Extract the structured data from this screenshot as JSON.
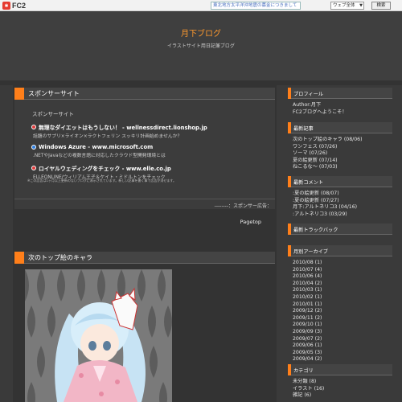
{
  "fc2bar": {
    "logo_text": "FC2",
    "notice": "東北地方太平洋沖地震の募金につきまして",
    "search_scope": "ウェブ全体",
    "search_button": "検索"
  },
  "header": {
    "title": "月下ブログ",
    "subtitle": "イラストサイト用日記兼ブログ"
  },
  "sponsor": {
    "heading": "スポンサーサイト",
    "label": "スポンサーサイト",
    "ads": [
      {
        "title": "無理なダイエットはもうしない！ - wellnessdirect.lionshop.jp",
        "desc": "話題のサプリ×ライオン×ラクトフェリン スッキリ計画始めませんか？",
        "icon": "red"
      },
      {
        "title": "Windows Azure - www.microsoft.com",
        "desc": ".NETやJavaなどの複数言語に対応したクラウド型開発環境とは",
        "icon": "blue"
      },
      {
        "title": "ロイヤルウェディングをチェック - www.elle.co.jp",
        "desc": "ELLEONLINE/ウィリアム王子＆ケイト・ミドルトンをチェック",
        "icon": "red"
      }
    ],
    "note": "※この広告は1ヶ月以上更新のないブログに表示されています。新しい記事を書く事で広告が消せます。",
    "footer": "--------：スポンサー広告："
  },
  "pagetop": "Pagetop",
  "entry": {
    "heading": "次のトップ絵のキャラ"
  },
  "sidebar": {
    "profile": {
      "heading": "プロフィール",
      "lines": [
        "Author:月下",
        "FC2ブログへようこそ！"
      ]
    },
    "recent_entries": {
      "heading": "最新記事",
      "items": [
        "次のトップ絵のキャラ (08/06)",
        "ワンフェス (07/26)",
        "ソーマ (07/26)",
        "夏の絵更新 (07/14)",
        "ねこるな～ (07/03)"
      ]
    },
    "recent_comments": {
      "heading": "最新コメント",
      "items": [
        ":夏の絵更新 (08/07)",
        ":夏の絵更新 (07/27)",
        "月下:アルトネリコ3 (04/16)",
        ":アルトネリコ3 (03/29)"
      ]
    },
    "trackbacks": {
      "heading": "最新トラックバック"
    },
    "archive": {
      "heading": "月別アーカイブ",
      "items": [
        "2010/08 (1)",
        "2010/07 (4)",
        "2010/06 (4)",
        "2010/04 (2)",
        "2010/03 (1)",
        "2010/02 (1)",
        "2010/01 (1)",
        "2009/12 (2)",
        "2009/11 (2)",
        "2009/10 (1)",
        "2009/09 (3)",
        "2009/07 (2)",
        "2009/06 (1)",
        "2009/05 (3)",
        "2009/04 (2)"
      ]
    },
    "categories": {
      "heading": "カテゴリ",
      "items": [
        "未分類 (8)",
        "イラスト (16)",
        "雑記 (6)"
      ]
    }
  }
}
